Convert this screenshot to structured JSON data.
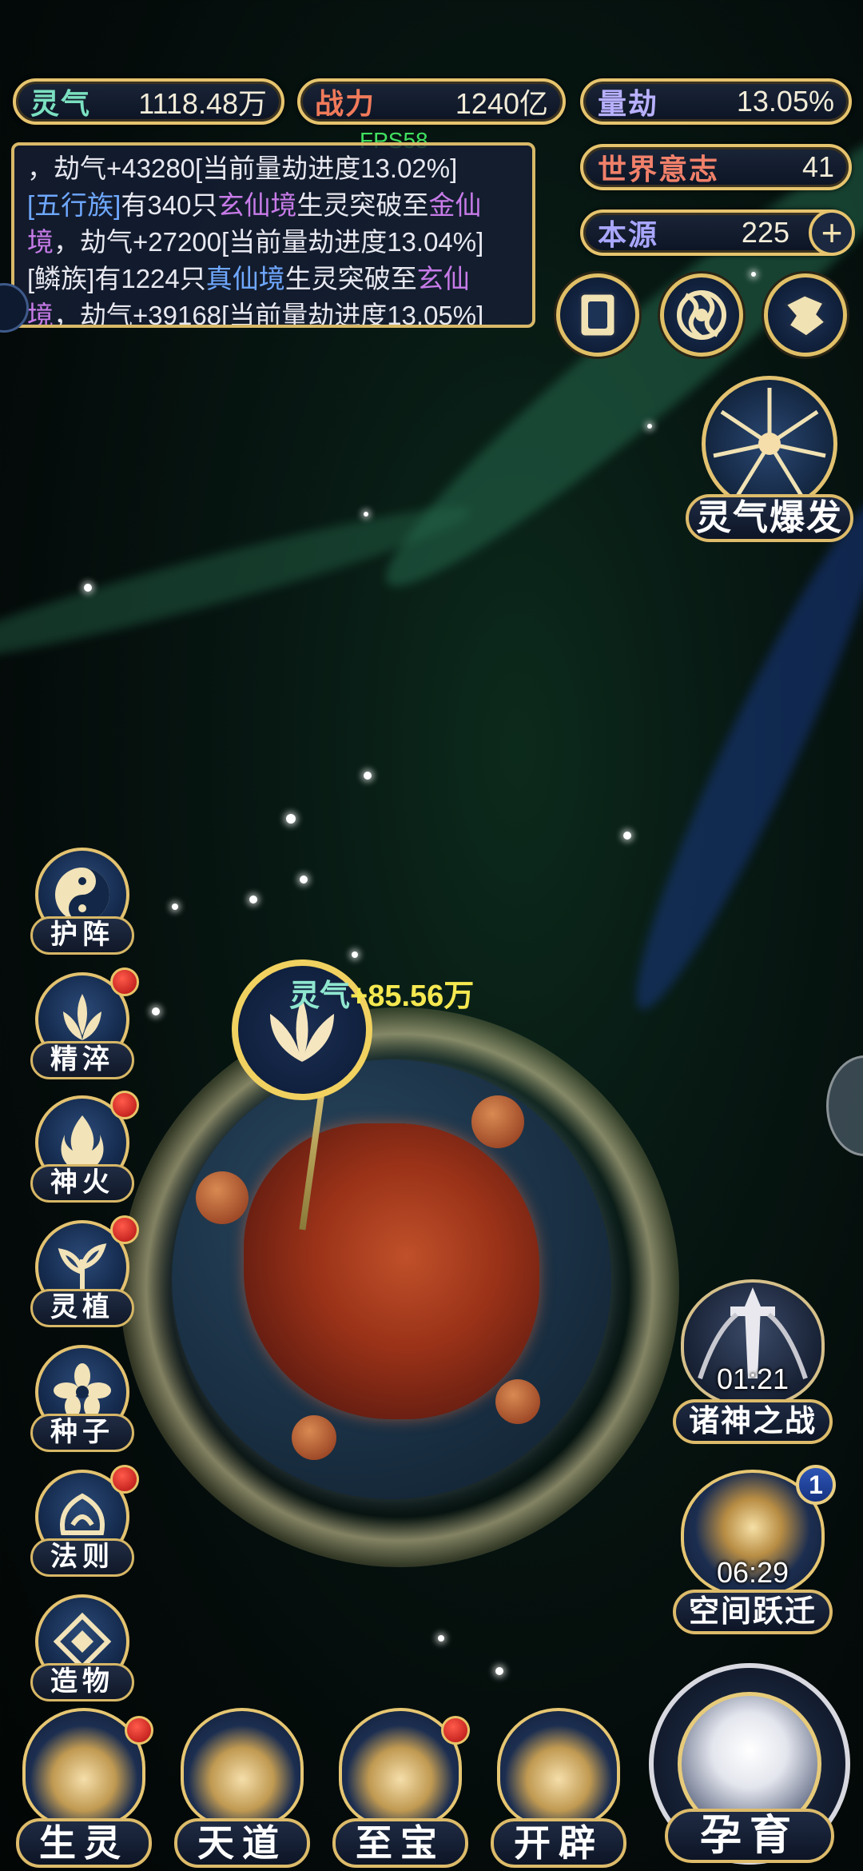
{
  "stats": {
    "lingqi": {
      "label": "灵气",
      "value": "1118.48万"
    },
    "zhanli": {
      "label": "战力",
      "value": "1240亿"
    },
    "liangjie": {
      "label": "量劫",
      "value": "13.05%"
    },
    "world_will": {
      "label": "世界意志",
      "value": "41"
    },
    "benyuan": {
      "label": "本源",
      "value": "225"
    },
    "plus": "+"
  },
  "fps": "FPS58",
  "log": {
    "line0": "，劫气+43280[当前量劫进度13.02%]",
    "e1": {
      "race": "[五行族]",
      "t1": "有340只",
      "realm_from": "玄仙境",
      "t2": "生灵突破至",
      "realm_to_a": "金仙",
      "realm_to_b": "境",
      "t3": "，劫气+27200[当前量劫进度13.04%]"
    },
    "e2": {
      "race_a": "[鳞族]",
      "t1": "有1224只",
      "realm_from": "真仙境",
      "t2": "生灵突破至",
      "realm_to_a": "玄仙",
      "realm_to_b": "境",
      "t3": "，劫气+39168[当前量劫进度13.05%]"
    }
  },
  "burst": {
    "label": "灵气爆发"
  },
  "planet": {
    "harvest_label": "灵气",
    "harvest_value": "+85.56万"
  },
  "side_buttons": [
    {
      "label": "护阵",
      "dot": false
    },
    {
      "label": "精淬",
      "dot": true
    },
    {
      "label": "神火",
      "dot": true
    },
    {
      "label": "灵植",
      "dot": true
    },
    {
      "label": "种子",
      "dot": false
    },
    {
      "label": "法则",
      "dot": true
    },
    {
      "label": "造物",
      "dot": false
    }
  ],
  "events": {
    "gods_war": {
      "time": "01:21",
      "label": "诸神之战"
    },
    "space_jump": {
      "time": "06:29",
      "label": "空间跃迁",
      "badge": "1"
    }
  },
  "tabs": {
    "shengling": "生灵",
    "tiandao": "天道",
    "zhibao": "至宝",
    "kaipi": "开辟",
    "yunyu": "孕育"
  },
  "colors": {
    "gold": "#e6c46e",
    "panel": "#161e34",
    "accent_blue": "#6fa8ff",
    "accent_purple": "#c77be8",
    "harvest": "#f5e850"
  }
}
